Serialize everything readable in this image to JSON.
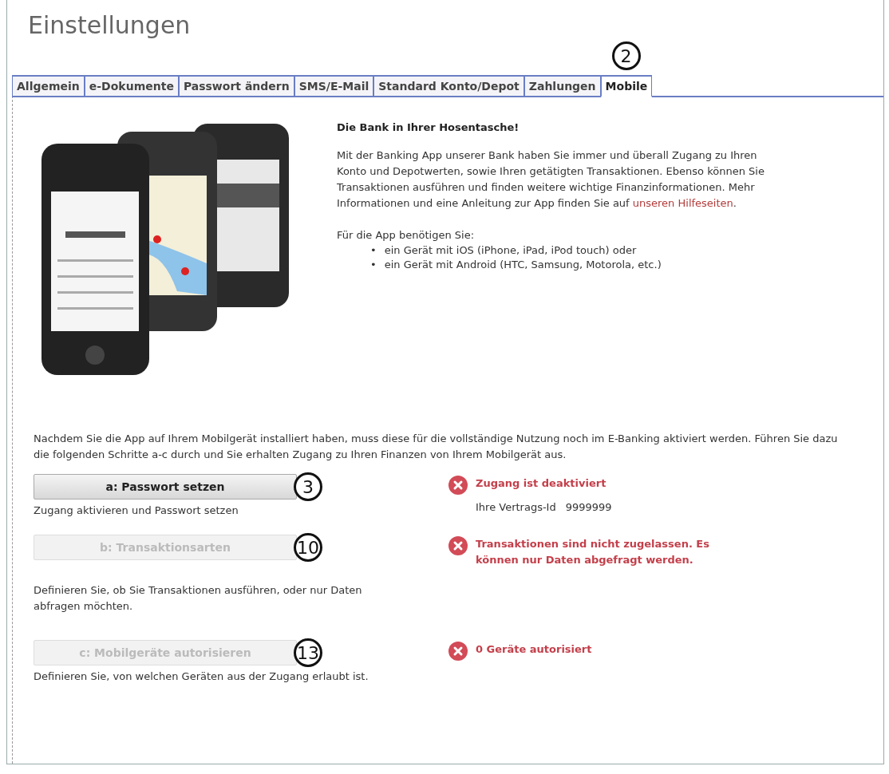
{
  "title": "Einstellungen",
  "tabs": [
    {
      "label": "Allgemein",
      "selected": false
    },
    {
      "label": "e-Dokumente",
      "selected": false
    },
    {
      "label": "Passwort ändern",
      "selected": false
    },
    {
      "label": "SMS/E-Mail",
      "selected": false
    },
    {
      "label": "Standard Konto/Depot",
      "selected": false
    },
    {
      "label": "Zahlungen",
      "selected": false
    },
    {
      "label": "Mobile",
      "selected": true,
      "callout": "2"
    }
  ],
  "intro": {
    "heading": "Die Bank in Ihrer Hosentasche!",
    "paragraph": "Mit der Banking App unserer Bank haben Sie immer und überall Zugang zu Ihren Konto und Depotwerten, sowie Ihren getätigten Transaktionen. Ebenso können Sie Transaktionen ausführen und finden weitere wichtige Finanzinformationen. Mehr Informationen und eine Anleitung zur App finden Sie auf",
    "link": "unseren Hilfeseiten",
    "paragraph_end": ".",
    "requirements_intro": "Für die App benötigen Sie:",
    "requirements": [
      {
        "bullet": "•",
        "text": "ein Gerät mit iOS (iPhone, iPad, iPod touch) oder"
      },
      {
        "bullet": "•",
        "text": "ein Gerät mit Android (HTC, Samsung, Motorola, etc.)"
      }
    ]
  },
  "instructions": "Nachdem Sie die App auf Ihrem Mobilgerät installiert haben, muss diese für die vollständige Nutzung noch im E-Banking aktiviert werden. Führen Sie dazu die folgenden Schritte a-c durch und Sie erhalten Zugang zu Ihren Finanzen von Ihrem Mobilgerät aus.",
  "steps": [
    {
      "button": {
        "label": "a: Passwort setzen",
        "disabled": false
      },
      "callout": "3",
      "description": "Zugang aktivieren und Passwort setzen",
      "status": {
        "ok": false,
        "message": "Zugang ist deaktiviert"
      },
      "detail": {
        "label": "Ihre Vertrags-Id",
        "value": "9999999"
      }
    },
    {
      "button": {
        "label": "b: Transaktionsarten",
        "disabled": true
      },
      "callout": "10",
      "description": "Definieren Sie, ob Sie Transaktionen ausführen, oder nur Daten abfragen möchten.",
      "status": {
        "ok": false,
        "message": "Transaktionen sind nicht zugelassen. Es können nur Daten abgefragt werden."
      }
    },
    {
      "button": {
        "label": "c: Mobilgeräte autorisieren",
        "disabled": true
      },
      "callout": "13",
      "description": "Definieren Sie, von welchen Geräten aus der Zugang erlaubt ist.",
      "status": {
        "ok": false,
        "message": "0 Geräte autorisiert"
      }
    }
  ]
}
